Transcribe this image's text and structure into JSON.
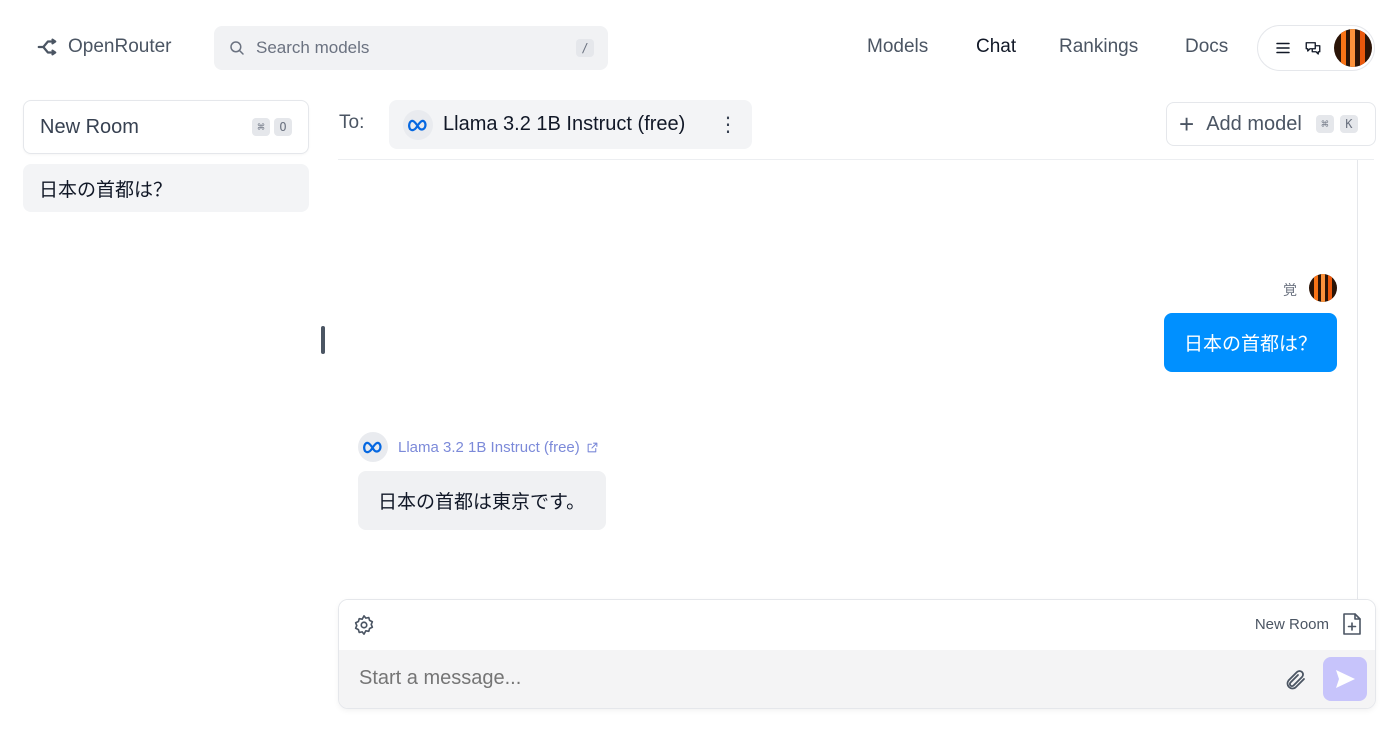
{
  "header": {
    "logo_text": "OpenRouter",
    "search_placeholder": "Search models",
    "search_shortcut": "/",
    "nav": [
      "Models",
      "Chat",
      "Rankings",
      "Docs"
    ],
    "active_nav": "Chat"
  },
  "sidebar": {
    "new_room_label": "New Room",
    "new_room_shortcut_mod": "⌘",
    "new_room_shortcut_key": "O",
    "rooms": [
      "日本の首都は？"
    ]
  },
  "chat": {
    "to_label": "To:",
    "model_name": "Llama 3.2 1B Instruct (free)",
    "model_menu": "⋮",
    "add_model_label": "Add model",
    "add_model_shortcut_mod": "⌘",
    "add_model_shortcut_key": "K",
    "messages": [
      {
        "role": "user",
        "author": "覚",
        "text": "日本の首都は？"
      },
      {
        "role": "assistant",
        "author": "Llama 3.2 1B Instruct (free)",
        "text": "日本の首都は東京です。"
      }
    ]
  },
  "composer": {
    "new_room_label": "New Room",
    "placeholder": "Start a message..."
  },
  "colors": {
    "accent": "#0090ff",
    "send_disabled": "#c7c4fb",
    "model_link": "#7c8ad9"
  }
}
